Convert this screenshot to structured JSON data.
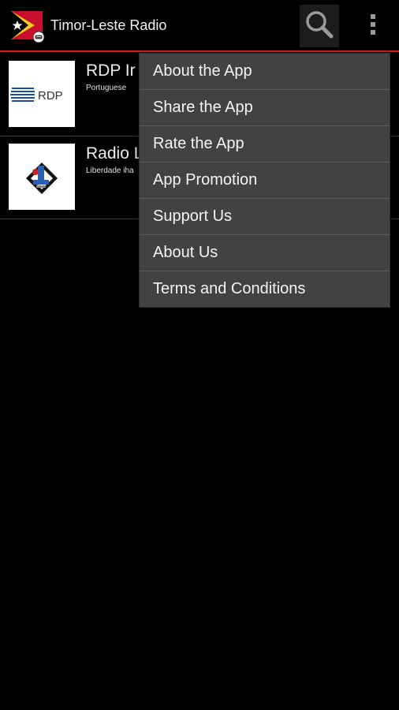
{
  "app": {
    "title": "Timor-Leste Radio",
    "logo_icon": "timor-leste-flag-radio-icon"
  },
  "toolbar": {
    "search_icon": "search-icon",
    "overflow_icon": "overflow-menu-icon"
  },
  "stations": [
    {
      "name": "RDP Ir",
      "description": "Portuguese",
      "logo_icon": "rdp-logo",
      "logo_text": "RDP"
    },
    {
      "name": "Radio L",
      "description": "Liberdade iha",
      "logo_icon": "radio-liberdade-logo"
    }
  ],
  "menu": {
    "items": [
      {
        "label": "About the App"
      },
      {
        "label": "Share the App"
      },
      {
        "label": "Rate the App"
      },
      {
        "label": "App Promotion"
      },
      {
        "label": "Support Us"
      },
      {
        "label": "About Us"
      },
      {
        "label": "Terms and Conditions"
      }
    ]
  },
  "colors": {
    "accent": "#c4261f",
    "menu_bg": "#424242",
    "background": "#000000"
  }
}
